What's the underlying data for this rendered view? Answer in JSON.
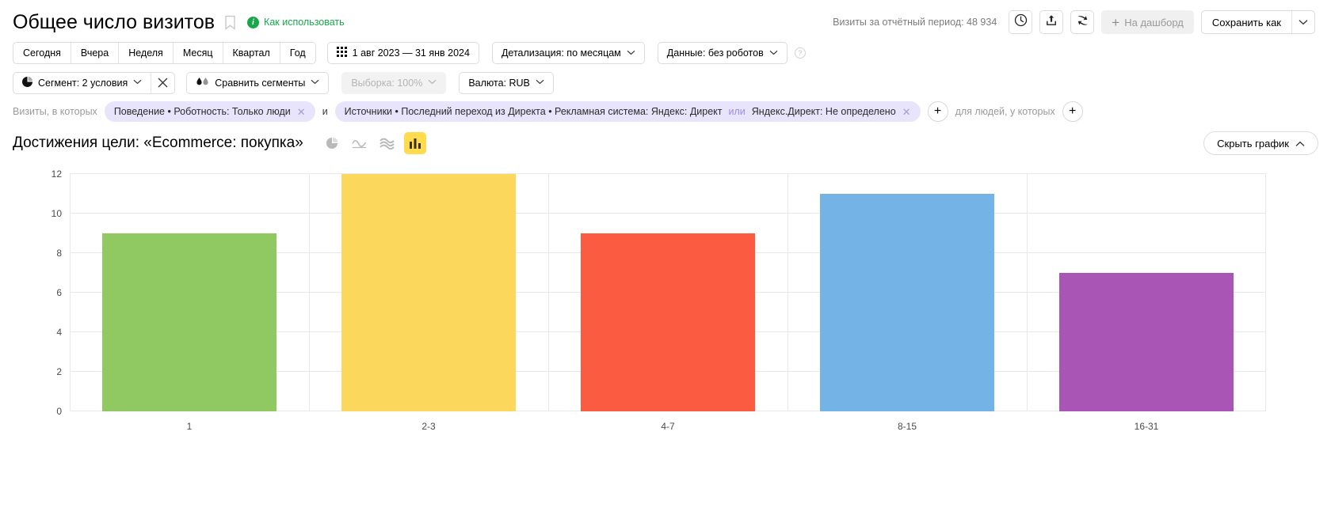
{
  "header": {
    "title": "Общее число визитов",
    "bookmark_icon": "bookmark-icon",
    "howto_label": "Как использовать",
    "howto_badge": "i",
    "visits_label": "Визиты за отчётный период: 48 934",
    "clock_icon": "clock-icon",
    "share_icon": "share-icon",
    "compare_icon": "compare-icon",
    "dashboard_label": "На дашборд",
    "dashboard_plus": "+",
    "save_as_label": "Сохранить как",
    "save_as_caret": "⌄"
  },
  "period": {
    "presets": [
      {
        "label": "Сегодня"
      },
      {
        "label": "Вчера"
      },
      {
        "label": "Неделя"
      },
      {
        "label": "Месяц"
      },
      {
        "label": "Квартал"
      },
      {
        "label": "Год"
      }
    ],
    "date_range": "1 авг 2023 — 31 янв 2024",
    "calendar_icon": "calendar-icon",
    "detail_label": "Детализация: по месяцам",
    "data_label": "Данные: без роботов",
    "help_icon": "?"
  },
  "segments": {
    "segment_label": "Сегмент: 2 условия",
    "segment_icon": "pie-icon",
    "close_icon": "×",
    "compare_label": "Сравнить сегменты",
    "compare_icon": "droplets-icon",
    "sample_label": "Выборка: 100%",
    "currency_label": "Валюта: RUB",
    "caret": "⌄"
  },
  "filters": {
    "prefix_label": "Визиты, в которых",
    "conjunction": "и",
    "suffix_label": "для людей, у которых",
    "add_icon": "+",
    "chip_close": "✕",
    "chips": [
      {
        "text": "Поведение • Роботность: Только люди"
      },
      {
        "text_before": "Источники • Последний переход из Директа • Рекламная система: Яндекс: Директ",
        "or": "или",
        "text_after": "Яндекс.Директ: Не определено"
      }
    ]
  },
  "chart_header": {
    "title": "Достижения цели: «Ecommerce: покупка»",
    "icons": [
      {
        "name": "pie-chart-icon",
        "active": false
      },
      {
        "name": "line-chart-icon",
        "active": false
      },
      {
        "name": "area-chart-icon",
        "active": false
      },
      {
        "name": "bar-chart-icon",
        "active": true
      }
    ],
    "hide_label": "Скрыть график",
    "hide_caret": "⌃"
  },
  "chart_data": {
    "type": "bar",
    "title": "Достижения цели: «Ecommerce: покупка»",
    "xlabel": "",
    "ylabel": "",
    "categories": [
      "1",
      "2-3",
      "4-7",
      "8-15",
      "16-31"
    ],
    "values": [
      9,
      12,
      9,
      11,
      7
    ],
    "colors": [
      "#90c862",
      "#fbd85c",
      "#fb5b40",
      "#74b3e5",
      "#a855b5"
    ],
    "ylim": [
      0,
      12
    ],
    "yticks": [
      0,
      2,
      4,
      6,
      8,
      10,
      12
    ],
    "grid": true,
    "legend": "none"
  }
}
